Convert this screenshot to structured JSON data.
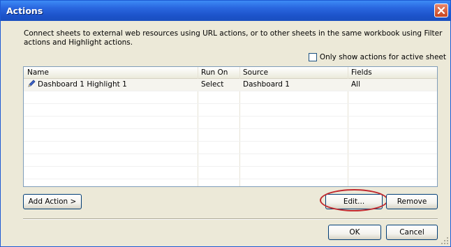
{
  "window": {
    "title": "Actions",
    "description": "Connect sheets to external web resources using URL actions, or to other sheets in the same workbook using Filter actions and Highlight actions.",
    "close_icon": "close-icon"
  },
  "filter_checkbox": {
    "label": "Only show actions for active sheet",
    "checked": false
  },
  "table": {
    "columns": [
      "Name",
      "Run On",
      "Source",
      "Fields"
    ],
    "rows": [
      {
        "icon": "pencil-icon",
        "name": "Dashboard 1 Highlight 1",
        "run_on": "Select",
        "source": "Dashboard 1",
        "fields": "All"
      }
    ]
  },
  "buttons": {
    "add_action": "Add Action >",
    "edit": "Edit...",
    "remove": "Remove",
    "ok": "OK",
    "cancel": "Cancel"
  },
  "colors": {
    "title_bar": "#2a67e0",
    "highlight_ring": "#c0282e",
    "dialog_bg": "#ece9d8"
  }
}
